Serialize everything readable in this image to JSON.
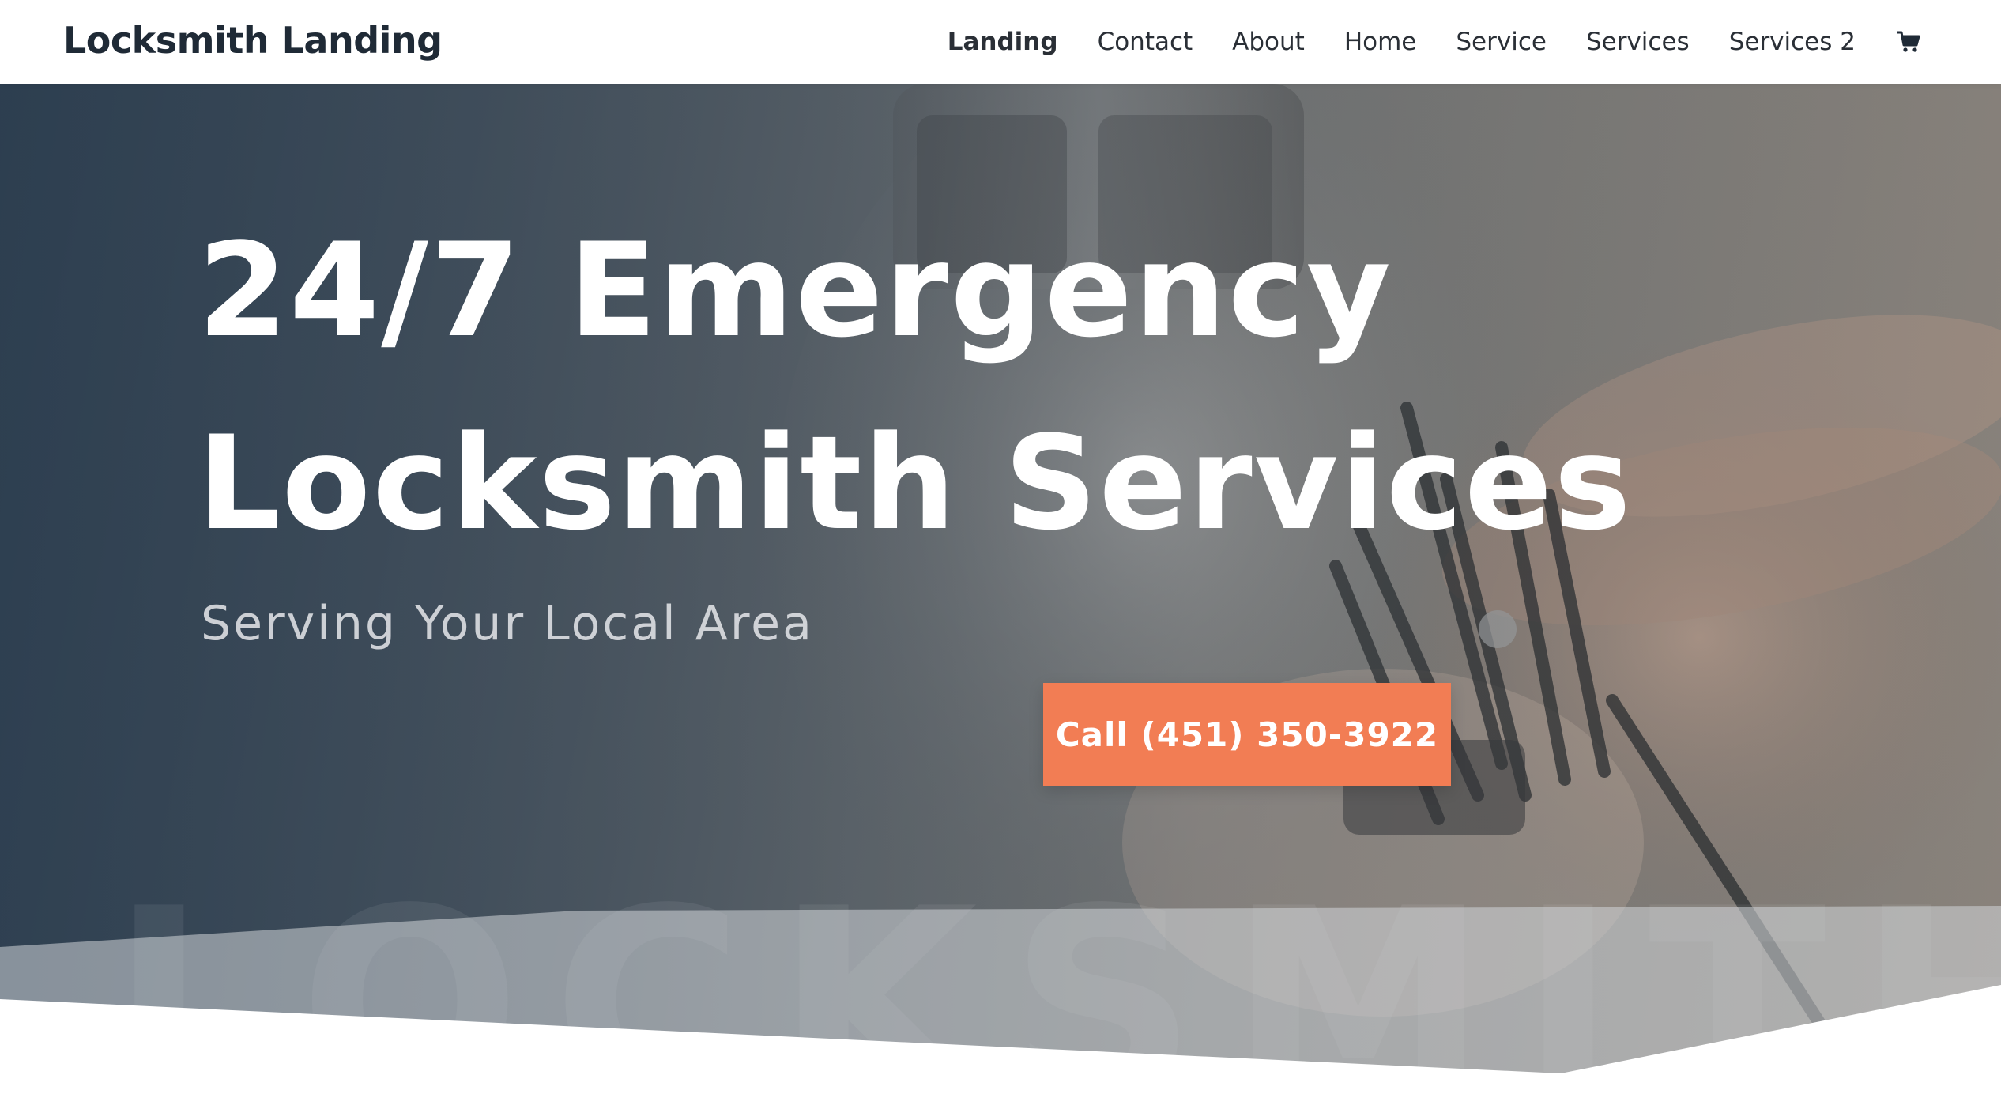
{
  "header": {
    "logo": "Locksmith Landing",
    "nav": [
      {
        "label": "Landing",
        "active": true
      },
      {
        "label": "Contact"
      },
      {
        "label": "About"
      },
      {
        "label": "Home"
      },
      {
        "label": "Service"
      },
      {
        "label": "Services"
      },
      {
        "label": "Services 2"
      }
    ],
    "cart_icon": "shopping-cart-icon"
  },
  "hero": {
    "headline_line1": "24/7 Emergency",
    "headline_line2": "Locksmith Services",
    "subheadline": "Serving Your Local Area",
    "cta_label": "Call (451) 350-3922",
    "watermark": "LOCKSMITH",
    "background_image": "hand-holding-lock-picks-photo"
  },
  "colors": {
    "accent": "#f27d54",
    "header_text": "#1f2a36",
    "hero_overlay": "#2f4050"
  }
}
